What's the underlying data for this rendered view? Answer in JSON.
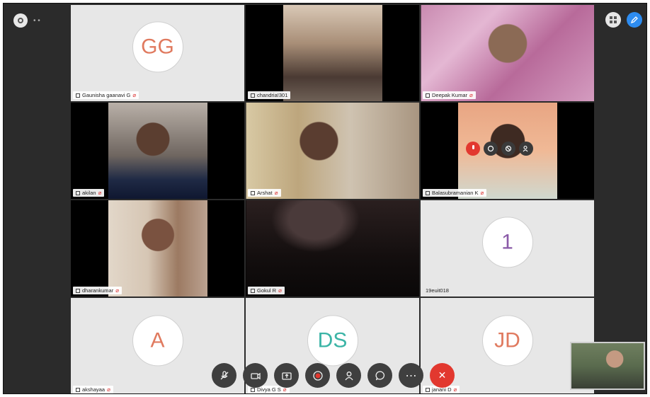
{
  "window": {
    "top_left_text": "•  •"
  },
  "participants": [
    {
      "name": "Gaunisha gaanavi G",
      "initials": "GG",
      "video": false,
      "color": "orange"
    },
    {
      "name": "chandria!301",
      "video": true
    },
    {
      "name": "Deepak Kumar",
      "video": true
    },
    {
      "name": "akilan",
      "video": true
    },
    {
      "name": "Arshat",
      "video": true
    },
    {
      "name": "Balasubramanian K",
      "video": true
    },
    {
      "name": "dharankumar",
      "video": true
    },
    {
      "name": "Gokul R",
      "video": true
    },
    {
      "name": "19euit018",
      "initials": "1",
      "video": false,
      "color": "purple"
    },
    {
      "name": "akshayaa",
      "initials": "A",
      "video": false,
      "color": "orange"
    },
    {
      "name": "Divya G S",
      "initials": "DS",
      "video": false,
      "color": "teal"
    },
    {
      "name": "janani D",
      "initials": "JD",
      "video": false,
      "color": "orange"
    }
  ],
  "toolbar": {
    "buttons": [
      "mute-mic",
      "stop-video",
      "share-screen",
      "record",
      "participants",
      "chat",
      "more",
      "leave-meeting"
    ],
    "more_label": "⋯",
    "leave_label": "✕"
  },
  "colors": {
    "accent": "#2d8cf0",
    "leave": "#e2382f",
    "record": "#e2382f"
  }
}
